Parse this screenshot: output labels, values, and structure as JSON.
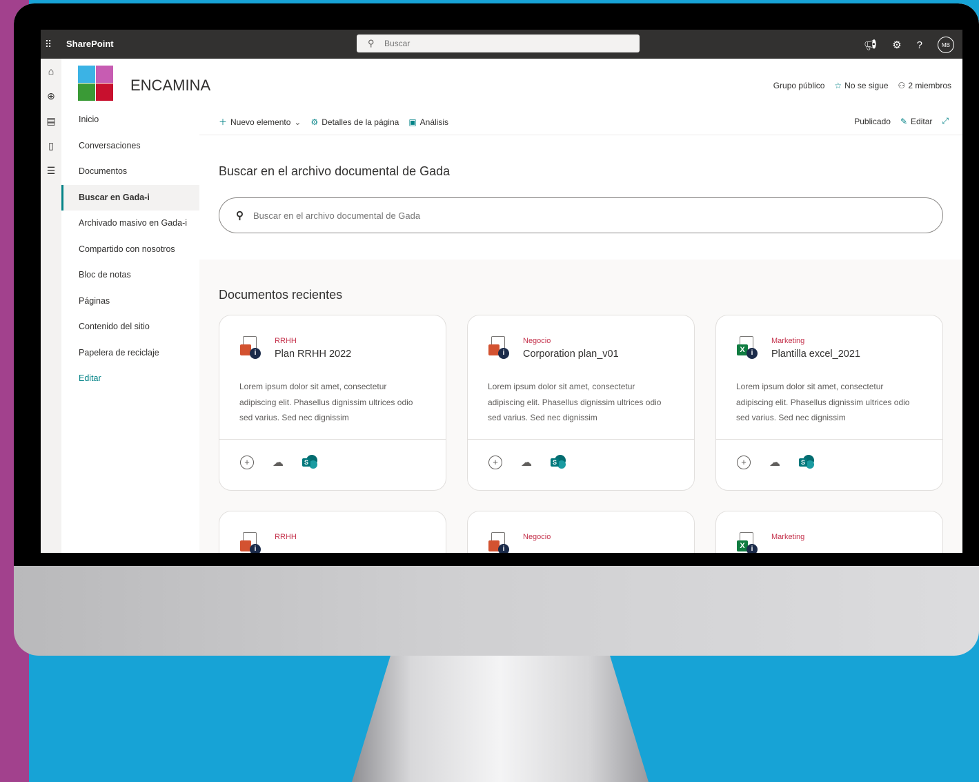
{
  "topbar": {
    "app_name": "SharePoint",
    "search_placeholder": "Buscar",
    "avatar_initials": "MB"
  },
  "site": {
    "name": "ENCAMINA",
    "visibility": "Grupo público",
    "follow": "No se sigue",
    "members": "2 miembros"
  },
  "nav": {
    "items": [
      {
        "label": "Inicio"
      },
      {
        "label": "Conversaciones"
      },
      {
        "label": "Documentos"
      },
      {
        "label": "Buscar en Gada-i"
      },
      {
        "label": "Archivado masivo en Gada-i"
      },
      {
        "label": "Compartido con nosotros"
      },
      {
        "label": "Bloc de notas"
      },
      {
        "label": "Páginas"
      },
      {
        "label": "Contenido del sitio"
      },
      {
        "label": "Papelera de reciclaje"
      },
      {
        "label": "Editar"
      }
    ],
    "active_index": 3
  },
  "commandbar": {
    "new": "Nuevo elemento",
    "details": "Detalles de la página",
    "analytics": "Análisis",
    "status": "Publicado",
    "edit": "Editar"
  },
  "search_section": {
    "title": "Buscar en el archivo documental de Gada",
    "placeholder": "Buscar en el archivo documental de Gada"
  },
  "recent": {
    "title": "Documentos recientes",
    "cards": [
      {
        "category": "RRHH",
        "title": "Plan RRHH 2022",
        "description": "Lorem ipsum dolor sit amet, consectetur adipiscing elit. Phasellus dignissim ultrices odio sed varius. Sed nec dignissim",
        "type": "ppt"
      },
      {
        "category": "Negocio",
        "title": "Corporation plan_v01",
        "description": "Lorem ipsum dolor sit amet, consectetur adipiscing elit. Phasellus dignissim ultrices odio sed varius. Sed nec dignissim",
        "type": "ppt"
      },
      {
        "category": "Marketing",
        "title": "Plantilla excel_2021",
        "description": "Lorem ipsum dolor sit amet, consectetur adipiscing elit. Phasellus dignissim ultrices odio sed varius. Sed nec dignissim",
        "type": "xls"
      },
      {
        "category": "RRHH",
        "title": "",
        "description": "",
        "type": "ppt"
      },
      {
        "category": "Negocio",
        "title": "",
        "description": "",
        "type": "ppt"
      },
      {
        "category": "Marketing",
        "title": "",
        "description": "",
        "type": "xls"
      }
    ]
  },
  "colors": {
    "accent": "#038387",
    "category": "#c4314b",
    "topbar": "#323130",
    "background": "#17a3d6",
    "purple": "#a2418d",
    "ppt": "#d35230",
    "xls": "#107c41"
  }
}
